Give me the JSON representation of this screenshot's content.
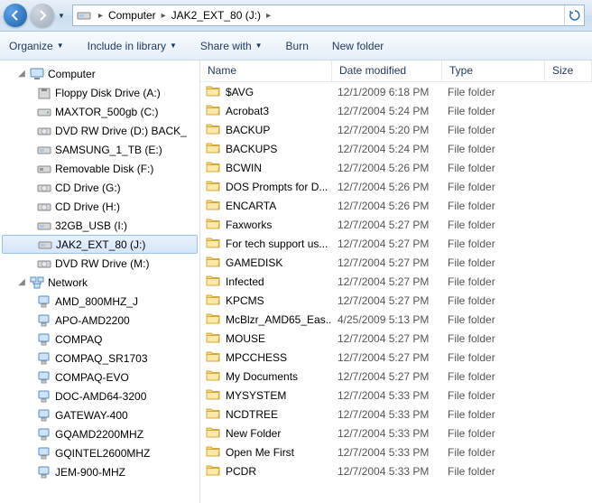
{
  "breadcrumb": {
    "root": "Computer",
    "current": "JAK2_EXT_80 (J:)"
  },
  "toolbar": {
    "organize": "Organize",
    "include": "Include in library",
    "share": "Share with",
    "burn": "Burn",
    "newfolder": "New folder"
  },
  "headers": {
    "name": "Name",
    "date": "Date modified",
    "type": "Type",
    "size": "Size"
  },
  "tree": {
    "computer": "Computer",
    "network": "Network",
    "computer_children": [
      {
        "label": "Floppy Disk Drive (A:)",
        "icon": "floppy"
      },
      {
        "label": "MAXTOR_500gb (C:)",
        "icon": "hdd"
      },
      {
        "label": "DVD RW Drive (D:) BACK_",
        "icon": "dvd"
      },
      {
        "label": "SAMSUNG_1_TB (E:)",
        "icon": "hdd-ext"
      },
      {
        "label": "Removable Disk (F:)",
        "icon": "removable"
      },
      {
        "label": "CD Drive (G:)",
        "icon": "cd"
      },
      {
        "label": "CD Drive (H:)",
        "icon": "cd"
      },
      {
        "label": "32GB_USB (I:)",
        "icon": "hdd-ext"
      },
      {
        "label": "JAK2_EXT_80 (J:)",
        "icon": "hdd-ext",
        "selected": true
      },
      {
        "label": "DVD RW Drive (M:)",
        "icon": "dvd"
      }
    ],
    "network_children": [
      {
        "label": "AMD_800MHZ_J"
      },
      {
        "label": "APO-AMD2200"
      },
      {
        "label": "COMPAQ"
      },
      {
        "label": "COMPAQ_SR1703"
      },
      {
        "label": "COMPAQ-EVO"
      },
      {
        "label": "DOC-AMD64-3200"
      },
      {
        "label": "GATEWAY-400"
      },
      {
        "label": "GQAMD2200MHZ"
      },
      {
        "label": "GQINTEL2600MHZ"
      },
      {
        "label": "JEM-900-MHZ"
      }
    ]
  },
  "files": [
    {
      "name": "$AVG",
      "date": "12/1/2009 6:18 PM",
      "type": "File folder"
    },
    {
      "name": "Acrobat3",
      "date": "12/7/2004 5:24 PM",
      "type": "File folder"
    },
    {
      "name": "BACKUP",
      "date": "12/7/2004 5:20 PM",
      "type": "File folder"
    },
    {
      "name": "BACKUPS",
      "date": "12/7/2004 5:24 PM",
      "type": "File folder"
    },
    {
      "name": "BCWIN",
      "date": "12/7/2004 5:26 PM",
      "type": "File folder"
    },
    {
      "name": "DOS Prompts for D...",
      "date": "12/7/2004 5:26 PM",
      "type": "File folder"
    },
    {
      "name": "ENCARTA",
      "date": "12/7/2004 5:26 PM",
      "type": "File folder"
    },
    {
      "name": "Faxworks",
      "date": "12/7/2004 5:27 PM",
      "type": "File folder"
    },
    {
      "name": "For tech support us...",
      "date": "12/7/2004 5:27 PM",
      "type": "File folder"
    },
    {
      "name": "GAMEDISK",
      "date": "12/7/2004 5:27 PM",
      "type": "File folder"
    },
    {
      "name": "Infected",
      "date": "12/7/2004 5:27 PM",
      "type": "File folder"
    },
    {
      "name": "KPCMS",
      "date": "12/7/2004 5:27 PM",
      "type": "File folder"
    },
    {
      "name": "McBlzr_AMD65_Eas...",
      "date": "4/25/2009 5:13 PM",
      "type": "File folder"
    },
    {
      "name": "MOUSE",
      "date": "12/7/2004 5:27 PM",
      "type": "File folder"
    },
    {
      "name": "MPCCHESS",
      "date": "12/7/2004 5:27 PM",
      "type": "File folder"
    },
    {
      "name": "My Documents",
      "date": "12/7/2004 5:27 PM",
      "type": "File folder"
    },
    {
      "name": "MYSYSTEM",
      "date": "12/7/2004 5:33 PM",
      "type": "File folder"
    },
    {
      "name": "NCDTREE",
      "date": "12/7/2004 5:33 PM",
      "type": "File folder"
    },
    {
      "name": "New Folder",
      "date": "12/7/2004 5:33 PM",
      "type": "File folder"
    },
    {
      "name": "Open Me First",
      "date": "12/7/2004 5:33 PM",
      "type": "File folder"
    },
    {
      "name": "PCDR",
      "date": "12/7/2004 5:33 PM",
      "type": "File folder"
    }
  ]
}
